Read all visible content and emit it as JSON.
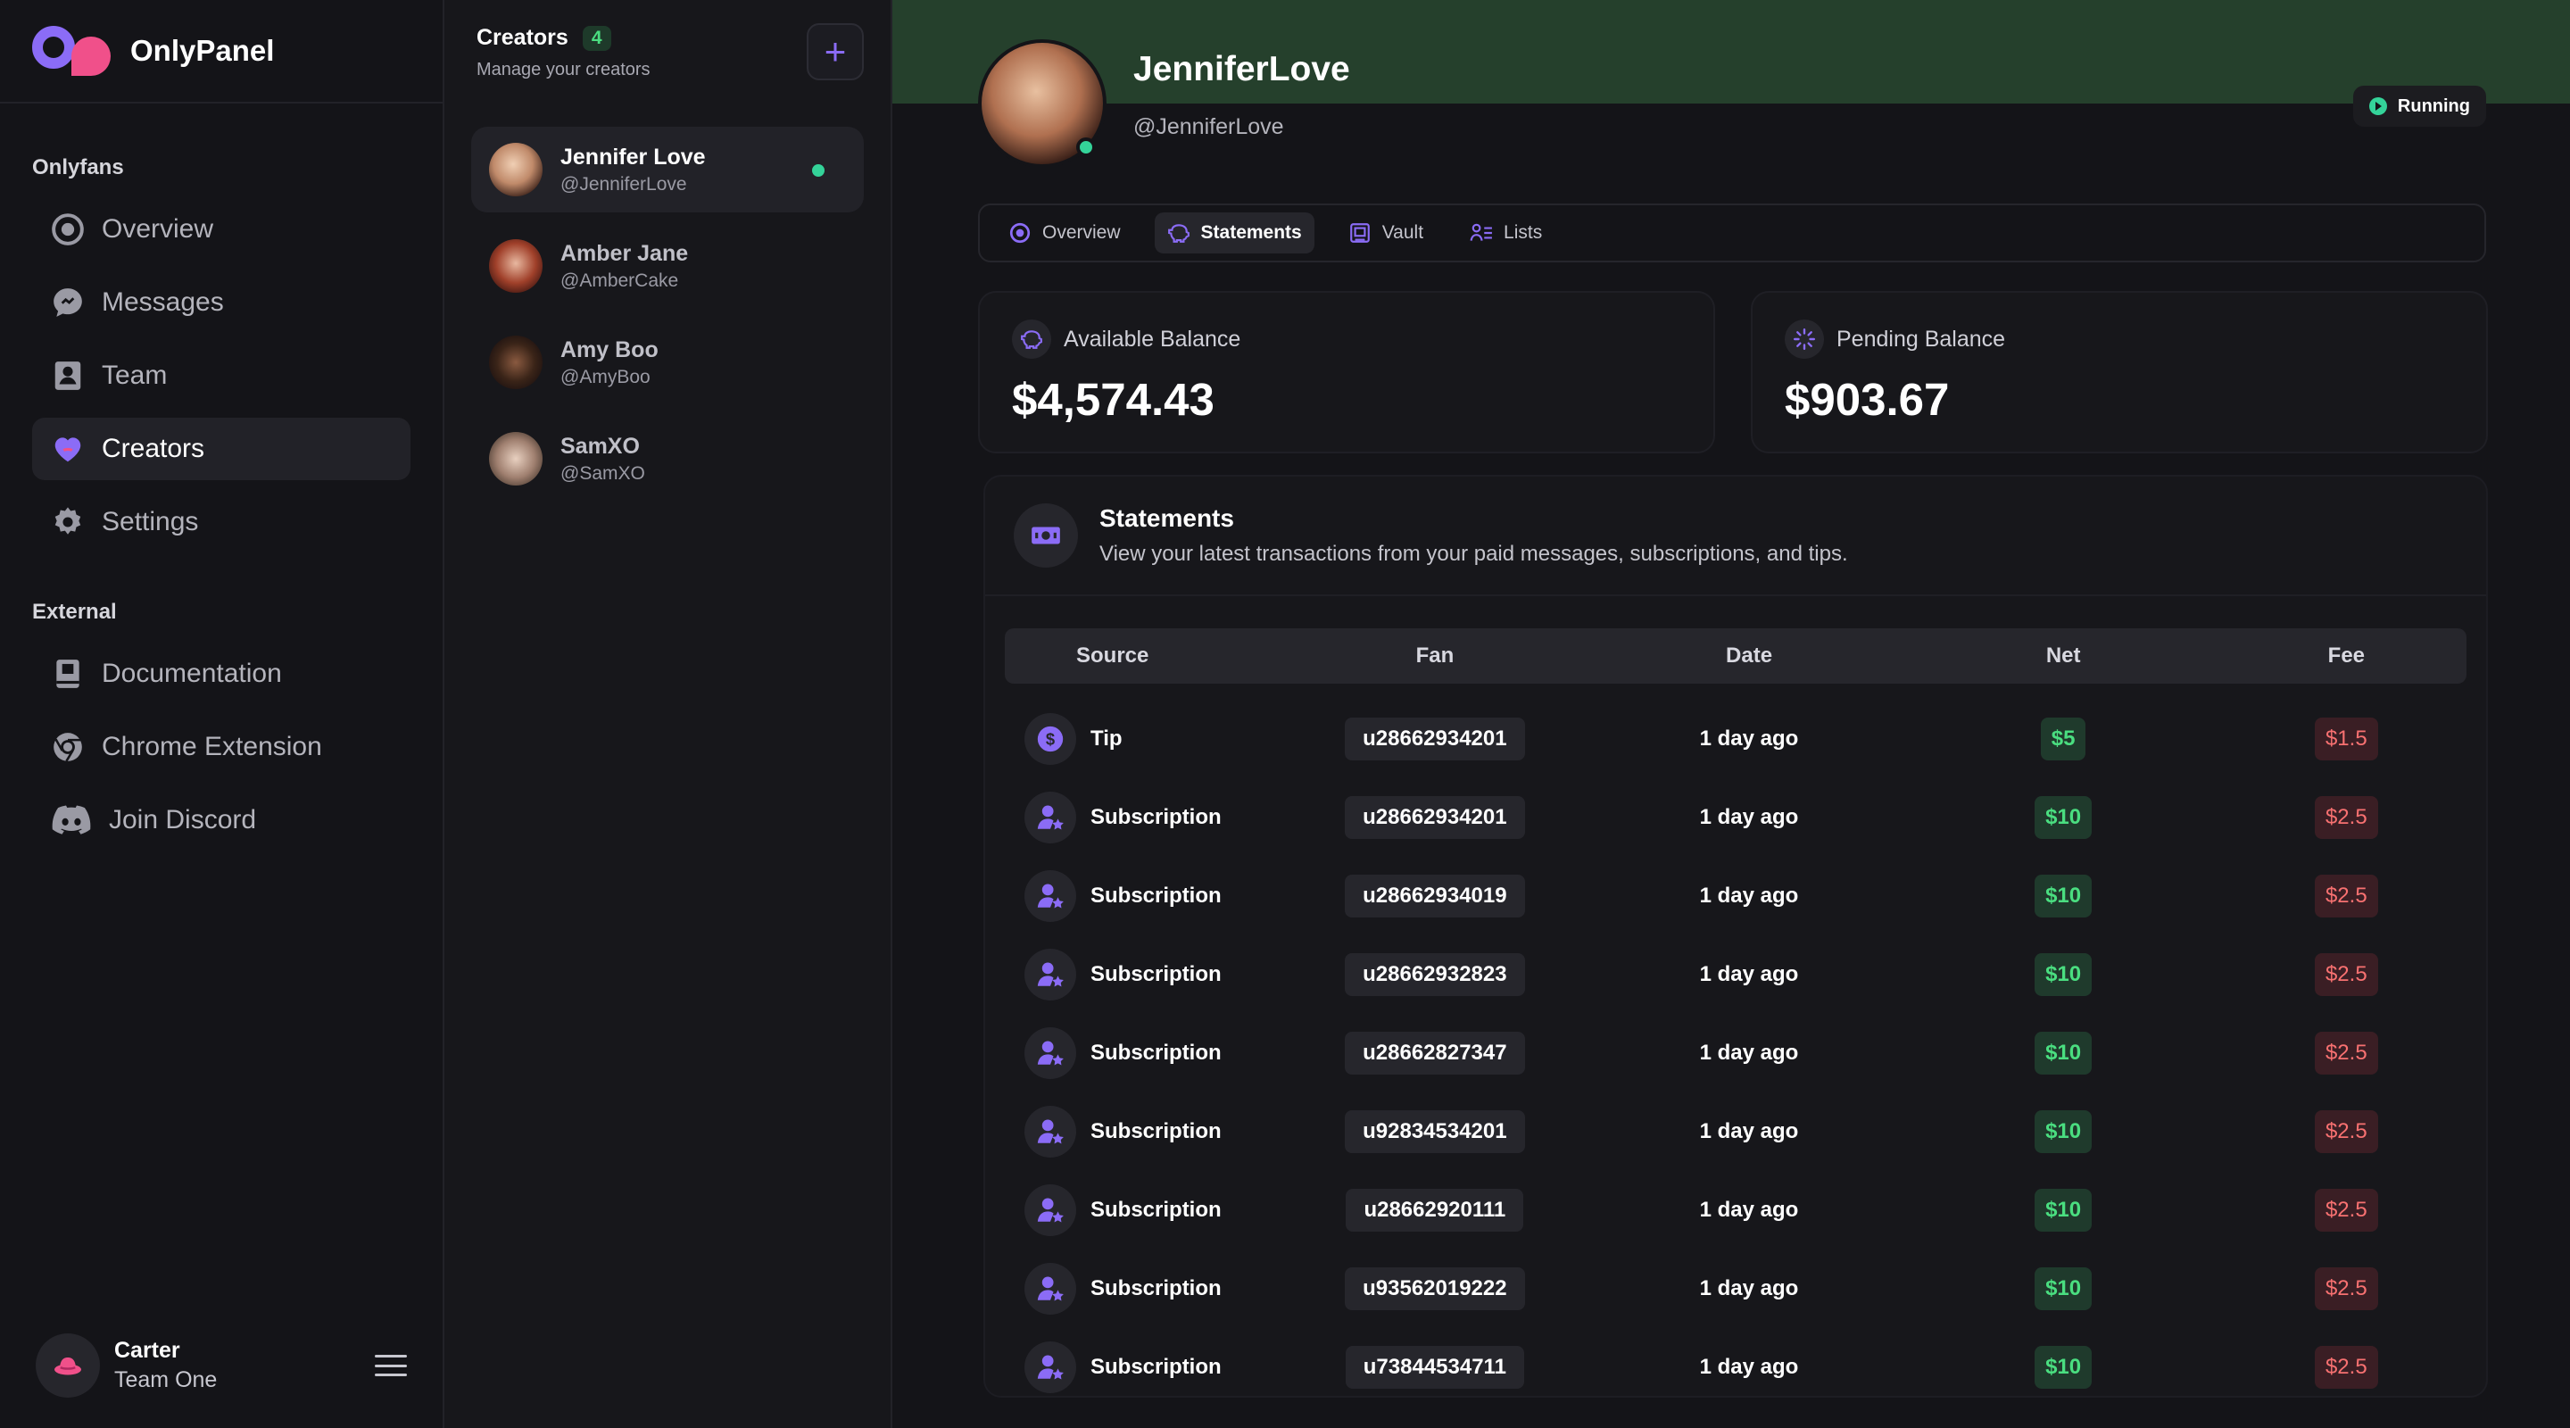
{
  "brand": {
    "name": "OnlyPanel"
  },
  "sidebar": {
    "section_onlyfans": "Onlyfans",
    "section_external": "External",
    "items": [
      {
        "label": "Overview",
        "icon": "overview-icon"
      },
      {
        "label": "Messages",
        "icon": "messages-icon"
      },
      {
        "label": "Team",
        "icon": "team-icon"
      },
      {
        "label": "Creators",
        "icon": "creators-icon",
        "active": true
      },
      {
        "label": "Settings",
        "icon": "settings-icon"
      }
    ],
    "external": [
      {
        "label": "Documentation",
        "icon": "book-icon"
      },
      {
        "label": "Chrome Extension",
        "icon": "chrome-icon"
      },
      {
        "label": "Join Discord",
        "icon": "discord-icon"
      }
    ],
    "user": {
      "name": "Carter",
      "team": "Team One"
    }
  },
  "creators": {
    "title": "Creators",
    "count": "4",
    "subtitle": "Manage your creators",
    "add_label": "+",
    "list": [
      {
        "name": "Jennifer Love",
        "handle": "@JenniferLove",
        "online": true
      },
      {
        "name": "Amber Jane",
        "handle": "@AmberCake"
      },
      {
        "name": "Amy Boo",
        "handle": "@AmyBoo"
      },
      {
        "name": "SamXO",
        "handle": "@SamXO"
      }
    ]
  },
  "profile": {
    "name": "JenniferLove",
    "handle": "@JenniferLove",
    "status": "Running"
  },
  "tabs": [
    {
      "label": "Overview"
    },
    {
      "label": "Statements",
      "active": true
    },
    {
      "label": "Vault"
    },
    {
      "label": "Lists"
    }
  ],
  "balances": {
    "available_label": "Available Balance",
    "available_value": "$4,574.43",
    "pending_label": "Pending Balance",
    "pending_value": "$903.67"
  },
  "statements": {
    "title": "Statements",
    "description": "View your latest transactions from your paid messages, subscriptions, and tips.",
    "columns": [
      "Source",
      "Fan",
      "Date",
      "Net",
      "Fee"
    ],
    "rows": [
      {
        "source": "Tip",
        "fan": "u28662934201",
        "date": "1 day ago",
        "net": "$5",
        "fee": "$1.5"
      },
      {
        "source": "Subscription",
        "fan": "u28662934201",
        "date": "1 day ago",
        "net": "$10",
        "fee": "$2.5"
      },
      {
        "source": "Subscription",
        "fan": "u28662934019",
        "date": "1 day ago",
        "net": "$10",
        "fee": "$2.5"
      },
      {
        "source": "Subscription",
        "fan": "u28662932823",
        "date": "1 day ago",
        "net": "$10",
        "fee": "$2.5"
      },
      {
        "source": "Subscription",
        "fan": "u28662827347",
        "date": "1 day ago",
        "net": "$10",
        "fee": "$2.5"
      },
      {
        "source": "Subscription",
        "fan": "u92834534201",
        "date": "1 day ago",
        "net": "$10",
        "fee": "$2.5"
      },
      {
        "source": "Subscription",
        "fan": "u28662920111",
        "date": "1 day ago",
        "net": "$10",
        "fee": "$2.5"
      },
      {
        "source": "Subscription",
        "fan": "u93562019222",
        "date": "1 day ago",
        "net": "$10",
        "fee": "$2.5"
      },
      {
        "source": "Subscription",
        "fan": "u73844534711",
        "date": "1 day ago",
        "net": "$10",
        "fee": "$2.5"
      }
    ]
  },
  "colors": {
    "accent": "#8b6cf6",
    "brand_pink": "#f0508a",
    "positive": "#4ade80",
    "negative": "#f87171",
    "banner": "#25402c"
  }
}
